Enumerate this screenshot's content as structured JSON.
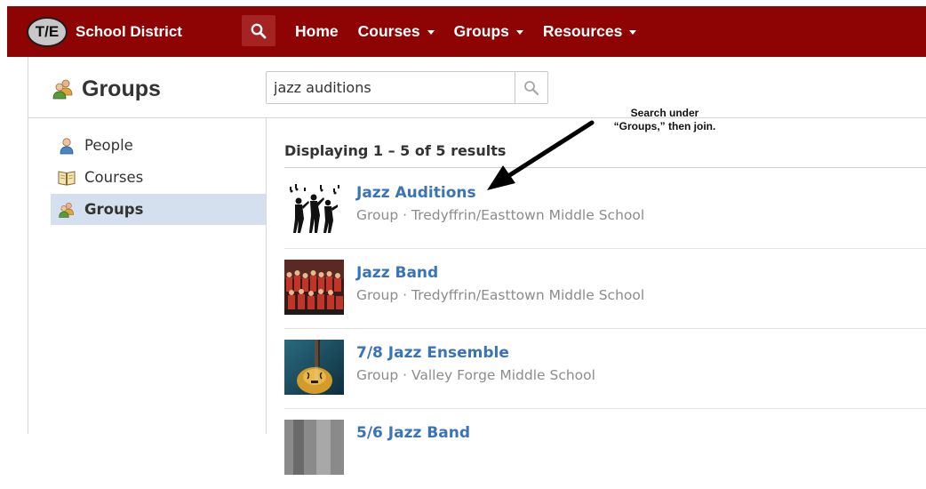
{
  "app": {
    "logo_badge": "T/E",
    "logo_text": "School District",
    "brand_color": "#8e0404"
  },
  "nav": {
    "search_icon": "search-icon",
    "items": [
      {
        "label": "Home",
        "has_dropdown": false
      },
      {
        "label": "Courses",
        "has_dropdown": true
      },
      {
        "label": "Groups",
        "has_dropdown": true
      },
      {
        "label": "Resources",
        "has_dropdown": true
      }
    ]
  },
  "page": {
    "title": "Groups",
    "title_icon": "groups-icon"
  },
  "search": {
    "value": "jazz auditions",
    "button_icon": "search-icon"
  },
  "sidebar": {
    "items": [
      {
        "label": "People",
        "icon": "person-icon",
        "active": false
      },
      {
        "label": "Courses",
        "icon": "book-icon",
        "active": false
      },
      {
        "label": "Groups",
        "icon": "groups-icon",
        "active": true
      }
    ],
    "active_color": "#d4e0ee"
  },
  "results": {
    "heading": "Displaying 1 – 5 of 5 results",
    "link_color": "#3a74b4",
    "items": [
      {
        "name": "Jazz Auditions",
        "meta": "Group · Tredyffrin/Easttown Middle School",
        "thumb": "jazz-silhouette-image"
      },
      {
        "name": "Jazz Band",
        "meta": "Group · Tredyffrin/Easttown Middle School",
        "thumb": "band-photo-image"
      },
      {
        "name": "7/8 Jazz Ensemble",
        "meta": "Group · Valley Forge Middle School",
        "thumb": "guitar-photo-image"
      },
      {
        "name": "5/6 Jazz Band",
        "meta": "",
        "thumb": "band-photo-gray-image"
      }
    ]
  },
  "annotation": {
    "line1": "Search under",
    "line2": "“Groups,” then join."
  }
}
